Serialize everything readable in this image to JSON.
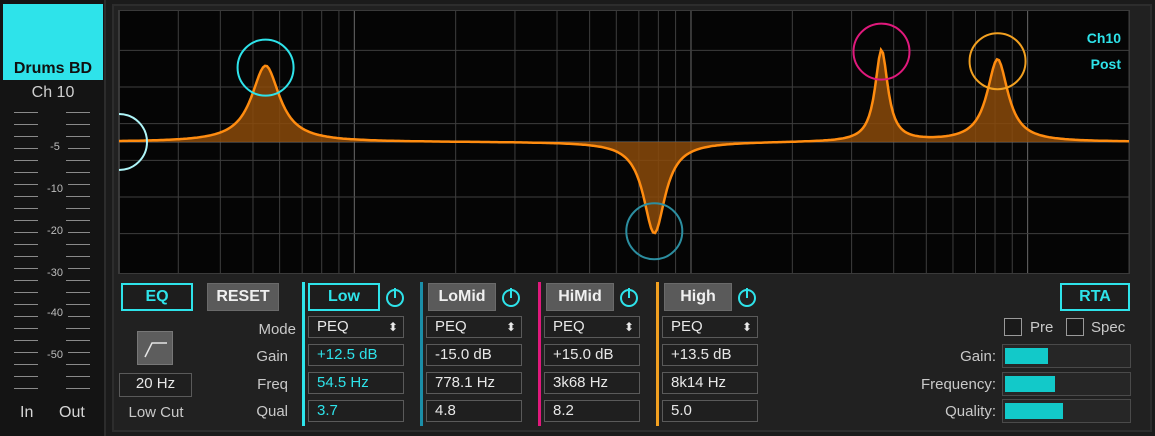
{
  "channel": {
    "name": "Drums BD",
    "number": "Ch 10",
    "scale": [
      "-5",
      "-10",
      "-20",
      "-30",
      "-40",
      "-50"
    ],
    "in_label": "In",
    "out_label": "Out"
  },
  "graph": {
    "info_line1": "Ch10",
    "info_line2": "Post"
  },
  "buttons": {
    "eq": "EQ",
    "reset": "RESET",
    "rta": "RTA"
  },
  "lowcut": {
    "freq": "20 Hz",
    "label": "Low Cut"
  },
  "row_labels": {
    "mode": "Mode",
    "gain": "Gain",
    "freq": "Freq",
    "qual": "Qual"
  },
  "bands": [
    {
      "name": "Low",
      "mode": "PEQ",
      "gain": "+12.5 dB",
      "freq": "54.5 Hz",
      "qual": "3.7",
      "color": "#2ee3ea",
      "active": true
    },
    {
      "name": "LoMid",
      "mode": "PEQ",
      "gain": "-15.0 dB",
      "freq": "778.1 Hz",
      "qual": "4.8",
      "color": "#1b8ea8",
      "active": false
    },
    {
      "name": "HiMid",
      "mode": "PEQ",
      "gain": "+15.0 dB",
      "freq": "3k68 Hz",
      "qual": "8.2",
      "color": "#e0197c",
      "active": false
    },
    {
      "name": "High",
      "mode": "PEQ",
      "gain": "+13.5 dB",
      "freq": "8k14 Hz",
      "qual": "5.0",
      "color": "#f2a020",
      "active": false
    }
  ],
  "rta": {
    "pre_label": "Pre",
    "spec_label": "Spec",
    "gain_label": "Gain:",
    "freq_label": "Frequency:",
    "quality_label": "Quality:",
    "gain_level": 0.35,
    "freq_level": 0.41,
    "quality_level": 0.47
  },
  "colors": {
    "accent": "#2ee3ea",
    "curve": "#ff8c10"
  }
}
